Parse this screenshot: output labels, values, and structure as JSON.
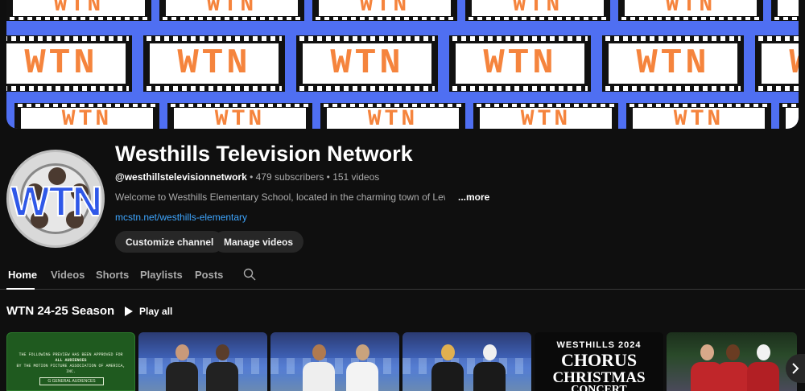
{
  "banner": {
    "logo_text": "WTN",
    "accent_colors": {
      "background": "#4f6ff2",
      "letters": "#f5843d",
      "film": "#111111"
    }
  },
  "channel": {
    "avatar_text": "WTN",
    "name": "Westhills Television Network",
    "handle": "@westhillstelevisionnetwork",
    "stats": " • 479 subscribers • 151 videos",
    "description": "Welcome to Westhills Elementary School, located in the charming town of Lewisburg,",
    "more_label": "...more",
    "link": "mcstn.net/westhills-elementary"
  },
  "buttons": {
    "customize": "Customize channel",
    "manage": "Manage videos"
  },
  "tabs": [
    {
      "label": "Home",
      "active": true
    },
    {
      "label": "Videos"
    },
    {
      "label": "Shorts"
    },
    {
      "label": "Playlists"
    },
    {
      "label": "Posts"
    }
  ],
  "section": {
    "title": "WTN 24-25 Season",
    "play_all": "Play all"
  },
  "thumbnails": {
    "t1_line1": "THE FOLLOWING PREVIEW HAS BEEN APPROVED FOR",
    "t1_line2": "ALL AUDIENCES",
    "t1_line3": "BY THE MOTION PICTURE ASSOCIATION OF AMERICA, INC.",
    "t1_rating": "G GENERAL AUDIENCES",
    "t5_line1": "WESTHILLS 2024",
    "t5_line2": "CHORUS",
    "t5_line3": "CHRISTMAS",
    "t5_line4": "CONCERT"
  },
  "icons": {
    "search": "search-icon",
    "play": "play-icon",
    "next": "chevron-right-icon"
  }
}
